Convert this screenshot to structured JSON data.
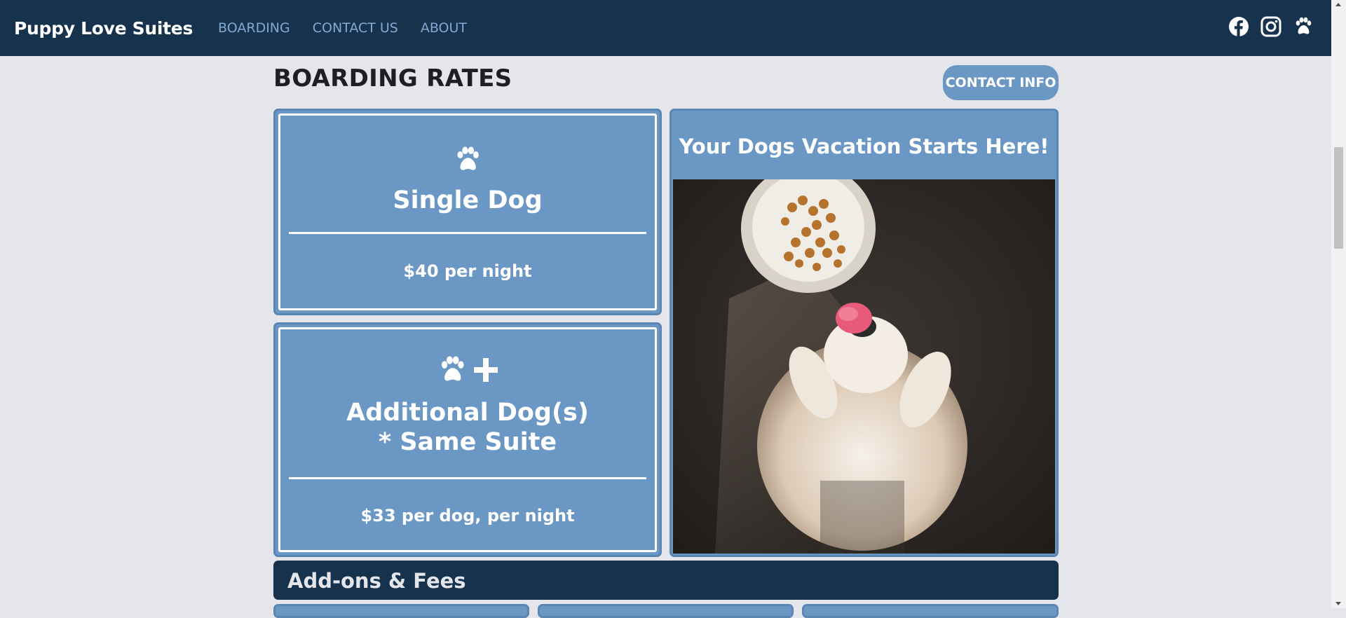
{
  "nav": {
    "brand": "Puppy Love Suites",
    "links": [
      "BOARDING",
      "CONTACT US",
      "ABOUT"
    ],
    "social_icons": [
      "facebook-icon",
      "instagram-icon",
      "paw-icon"
    ]
  },
  "header": {
    "title": "BOARDING RATES",
    "contact_button": "CONTACT INFO"
  },
  "rates": [
    {
      "icons": [
        "paw-icon"
      ],
      "title": "Single Dog",
      "price": "$40 per night"
    },
    {
      "icons": [
        "paw-icon",
        "plus-icon"
      ],
      "title_line1": "Additional Dog(s)",
      "title_line2": "* Same Suite",
      "price": "$33 per dog, per night"
    }
  ],
  "promo": {
    "heading": "Your Dogs Vacation Starts Here!",
    "image": "photo of a small fluffy dog licking its nose beside a food bowl"
  },
  "addons": {
    "title": "Add-ons & Fees"
  },
  "colors": {
    "navbar": "#17324d",
    "card": "#6b97c4",
    "nav_link": "#82a9d4",
    "page_bg": "#e4e6ec"
  }
}
